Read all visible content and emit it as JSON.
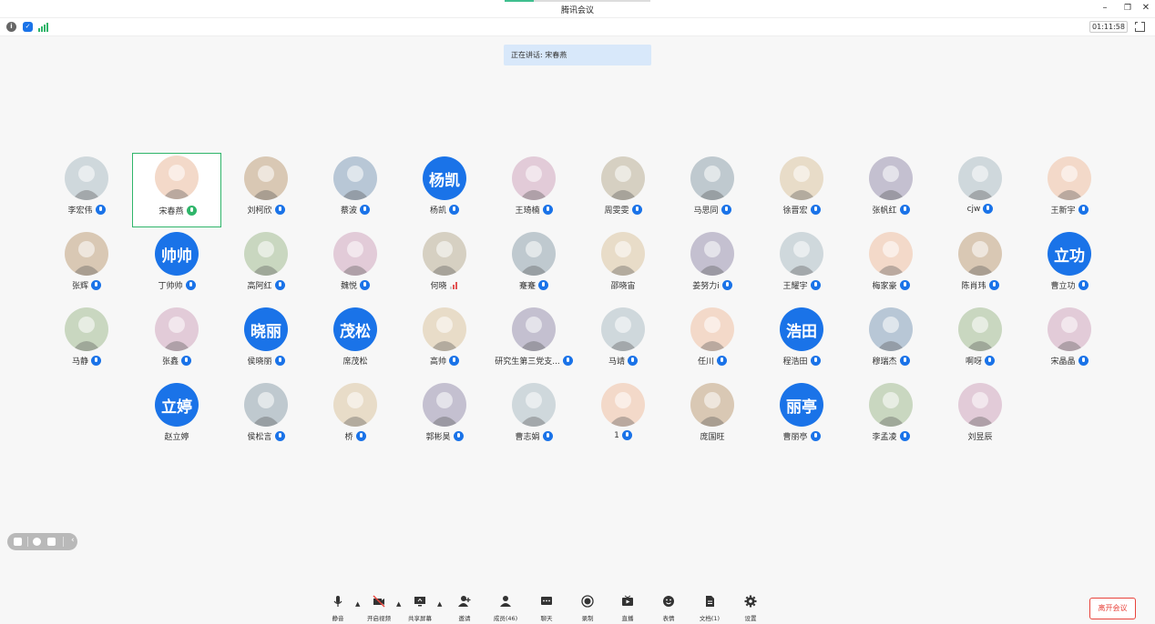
{
  "window": {
    "title": "腾讯会议",
    "timer": "01:11:58"
  },
  "speaking_banner": "正在讲话: 宋春燕",
  "participants": [
    {
      "name": "李宏伟",
      "avatar": "paper-crane"
    },
    {
      "name": "宋春燕",
      "avatar": "cartoon-girl",
      "active": true
    },
    {
      "name": "刘柯欣",
      "avatar": "cartoon-red-dress"
    },
    {
      "name": "蔡波",
      "avatar": "masked-person"
    },
    {
      "name": "杨凯",
      "avatar_text": "杨凯"
    },
    {
      "name": "王琦楠",
      "avatar": "photo"
    },
    {
      "name": "周雯雯",
      "avatar": "photo"
    },
    {
      "name": "马思同",
      "avatar": "photo"
    },
    {
      "name": "徐晋宏",
      "avatar": "photo"
    },
    {
      "name": "张帆红",
      "avatar": "cartoon"
    },
    {
      "name": "cjw",
      "avatar": "photo"
    },
    {
      "name": "王新宇",
      "avatar": "dog"
    },
    {
      "name": "张辉",
      "avatar": "cartoon-boy"
    },
    {
      "name": "丁帅帅",
      "avatar_text": "帅帅"
    },
    {
      "name": "高阿红",
      "avatar": "photo"
    },
    {
      "name": "魏悦",
      "avatar": "photo"
    },
    {
      "name": "何晓",
      "avatar": "cartoon-cat"
    },
    {
      "name": "蹇蹇",
      "avatar": "photo"
    },
    {
      "name": "邵晓宙",
      "avatar": "frog"
    },
    {
      "name": "姜努力i",
      "avatar": "cartoon"
    },
    {
      "name": "王耀宇",
      "avatar": "photo"
    },
    {
      "name": "梅家豪",
      "avatar": "cat"
    },
    {
      "name": "陈肖玮",
      "avatar": "cartoon-girl"
    },
    {
      "name": "曹立功",
      "avatar_text": "立功"
    },
    {
      "name": "马静",
      "avatar": "cartoon-duck"
    },
    {
      "name": "张鑫",
      "avatar": "photo"
    },
    {
      "name": "侯晓丽",
      "avatar_text": "晓丽"
    },
    {
      "name": "席茂松",
      "avatar_text": "茂松"
    },
    {
      "name": "高帅",
      "avatar": "cartoon-bear"
    },
    {
      "name": "研究生第三党支...",
      "avatar": "photo"
    },
    {
      "name": "马靖",
      "avatar": "photo"
    },
    {
      "name": "任川",
      "avatar": "default-person"
    },
    {
      "name": "程浩田",
      "avatar_text": "浩田"
    },
    {
      "name": "穆瑞杰",
      "avatar": "cartoon"
    },
    {
      "name": "啊呀",
      "avatar": "cartoon"
    },
    {
      "name": "宋晶晶",
      "avatar": "photo"
    },
    {
      "name": "赵立婷",
      "avatar_text": "立婷"
    },
    {
      "name": "侯松言",
      "avatar": "corgi"
    },
    {
      "name": "桥",
      "avatar": "cartoon-glasses"
    },
    {
      "name": "郭彬昊",
      "avatar": "shiba"
    },
    {
      "name": "曹志娟",
      "avatar": "photo"
    },
    {
      "name": "1",
      "avatar": "photo"
    },
    {
      "name": "庞国旺",
      "avatar": "photo"
    },
    {
      "name": "曹丽亭",
      "avatar_text": "丽亭"
    },
    {
      "name": "李孟凌",
      "avatar": "cartoon"
    },
    {
      "name": "刘昱辰",
      "avatar": "photo"
    }
  ],
  "toolbar": {
    "mute": "静音",
    "video": "开启视频",
    "share": "共享屏幕",
    "invite": "邀请",
    "members": "成员(46)",
    "chat": "聊天",
    "record": "录制",
    "live": "直播",
    "reaction": "表情",
    "docs": "文档(1)",
    "settings": "设置"
  },
  "leave_button": "离开会议",
  "colors": {
    "accent_blue": "#1a73e8",
    "active_green": "#2fb56a",
    "leave_red": "#e8433b"
  }
}
